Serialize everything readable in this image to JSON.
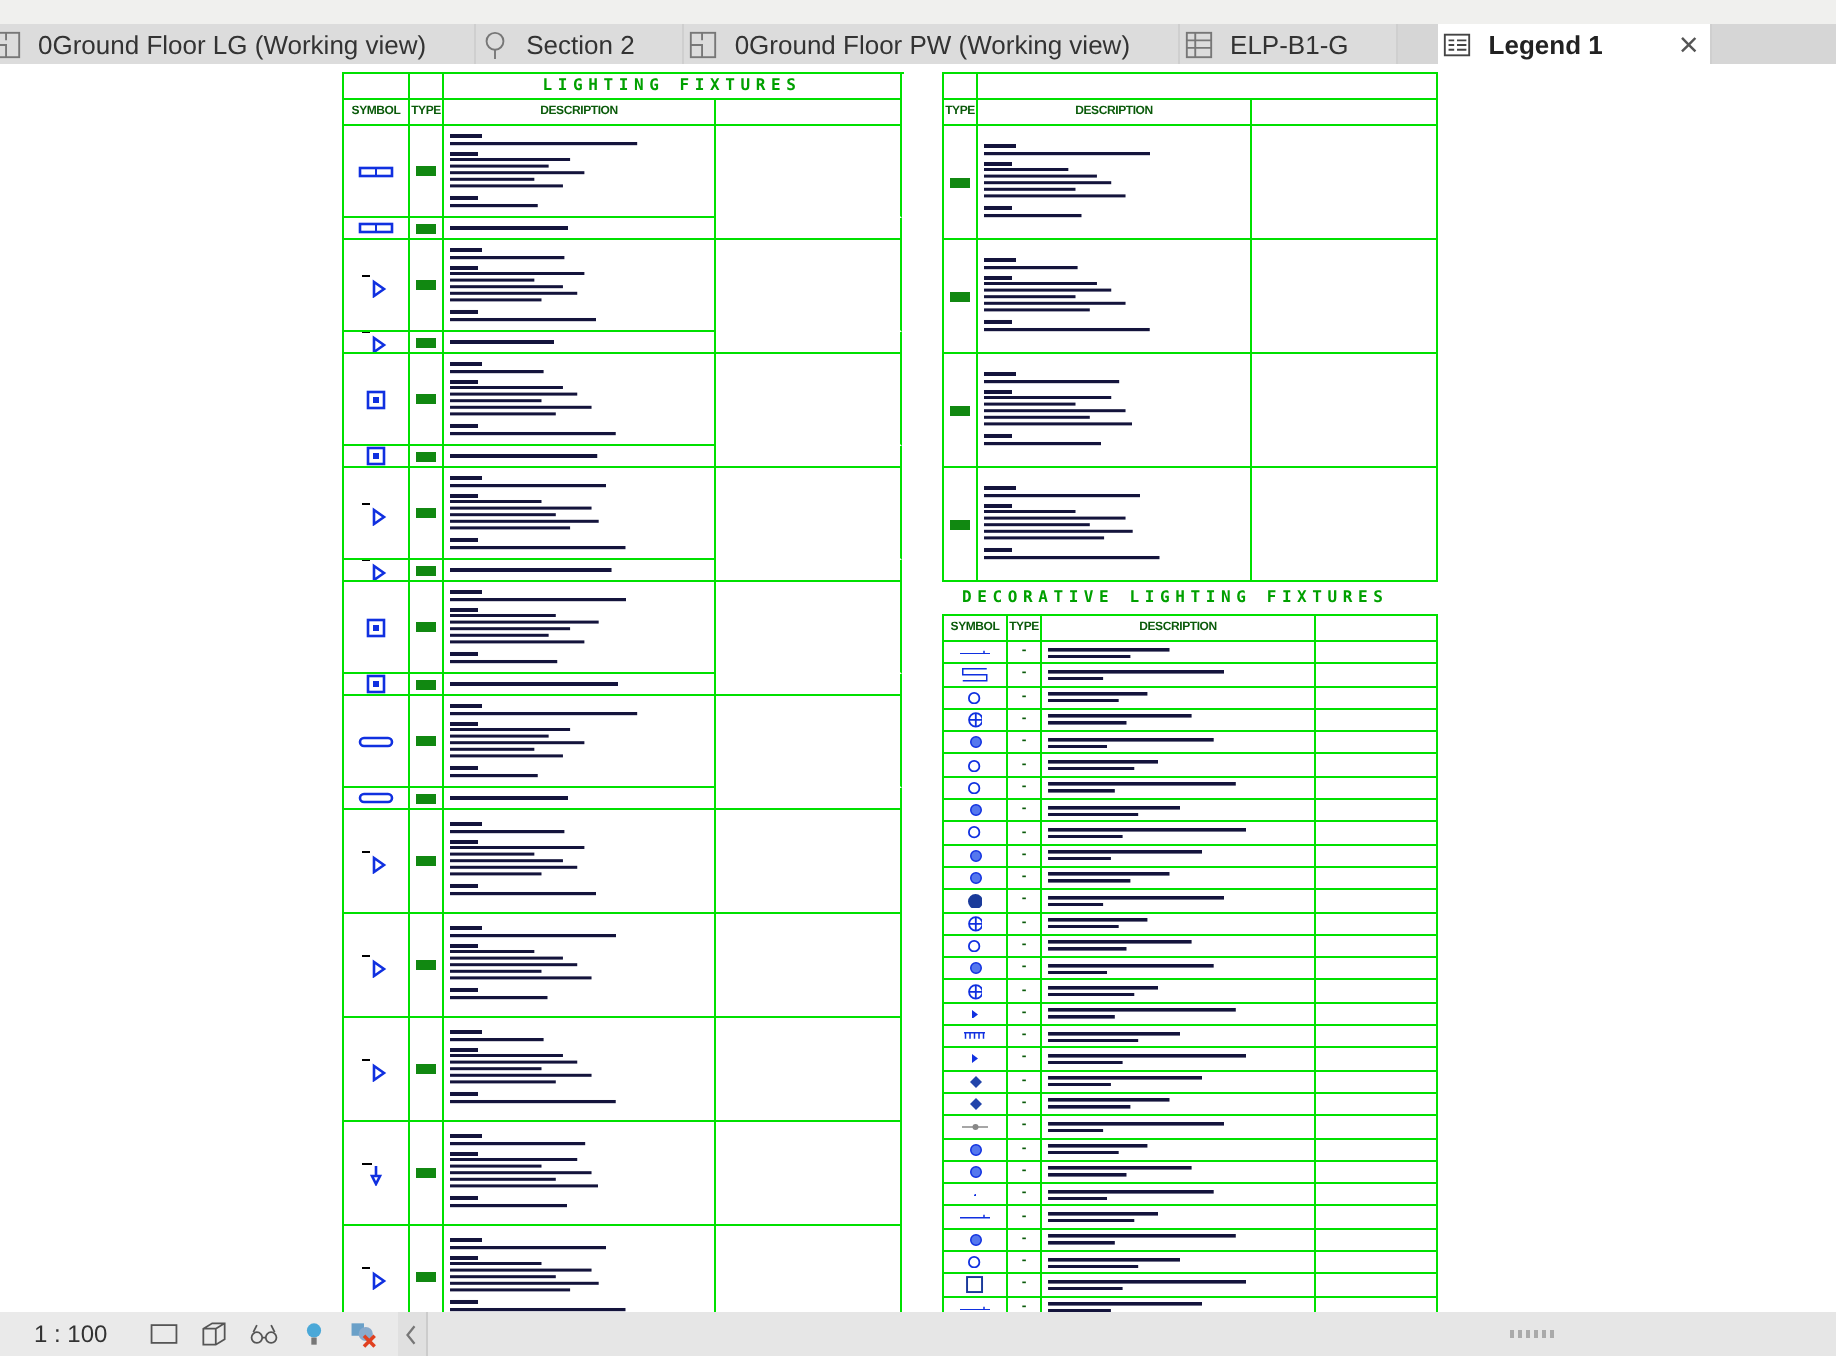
{
  "tabs": [
    {
      "label": "0Ground Floor LG (Working view)",
      "selected": false
    },
    {
      "label": "Section 2",
      "selected": false
    },
    {
      "label": "0Ground Floor PW (Working view)",
      "selected": false
    },
    {
      "label": "ELP-B1-G",
      "selected": false
    },
    {
      "label": "Legend 1",
      "selected": true,
      "close": "×"
    }
  ],
  "lighting_table": {
    "title": "LIGHTING FIXTURES",
    "columns": [
      "SYMBOL",
      "TYPE",
      "DESCRIPTION"
    ],
    "rows": [
      {
        "kind": "fixture"
      },
      {
        "kind": "variant"
      },
      {
        "kind": "fixture"
      },
      {
        "kind": "variant"
      },
      {
        "kind": "fixture"
      },
      {
        "kind": "variant"
      },
      {
        "kind": "fixture"
      },
      {
        "kind": "variant"
      },
      {
        "kind": "fixture"
      },
      {
        "kind": "variant"
      },
      {
        "kind": "fixture"
      },
      {
        "kind": "variant"
      },
      {
        "kind": "large"
      },
      {
        "kind": "large"
      },
      {
        "kind": "large"
      },
      {
        "kind": "large"
      },
      {
        "kind": "large"
      }
    ]
  },
  "spec_table": {
    "columns": [
      "TYPE",
      "DESCRIPTION"
    ],
    "rows": [
      {
        "kind": "spec"
      },
      {
        "kind": "spec"
      },
      {
        "kind": "spec"
      },
      {
        "kind": "spec"
      }
    ]
  },
  "decorative_table": {
    "title": "DECORATIVE LIGHTING FIXTURES",
    "columns": [
      "SYMBOL",
      "TYPE",
      "DESCRIPTION"
    ],
    "rows": [
      {
        "type": "-"
      },
      {
        "type": "-"
      },
      {
        "type": "-"
      },
      {
        "type": "-"
      },
      {
        "type": "-"
      },
      {
        "type": "-"
      },
      {
        "type": "-"
      },
      {
        "type": "-"
      },
      {
        "type": "-"
      },
      {
        "type": "-"
      },
      {
        "type": "-"
      },
      {
        "type": "-"
      },
      {
        "type": "-"
      },
      {
        "type": "-"
      },
      {
        "type": "-"
      },
      {
        "type": "-"
      },
      {
        "type": "-"
      },
      {
        "type": "-"
      },
      {
        "type": "-"
      },
      {
        "type": "-"
      },
      {
        "type": "-"
      },
      {
        "type": "-"
      },
      {
        "type": "-"
      },
      {
        "type": "-"
      },
      {
        "type": "-"
      },
      {
        "type": "-"
      },
      {
        "type": "-"
      },
      {
        "type": "-"
      },
      {
        "type": "-"
      },
      {
        "type": "-"
      }
    ]
  },
  "status_bar": {
    "scale": "1 : 100"
  }
}
